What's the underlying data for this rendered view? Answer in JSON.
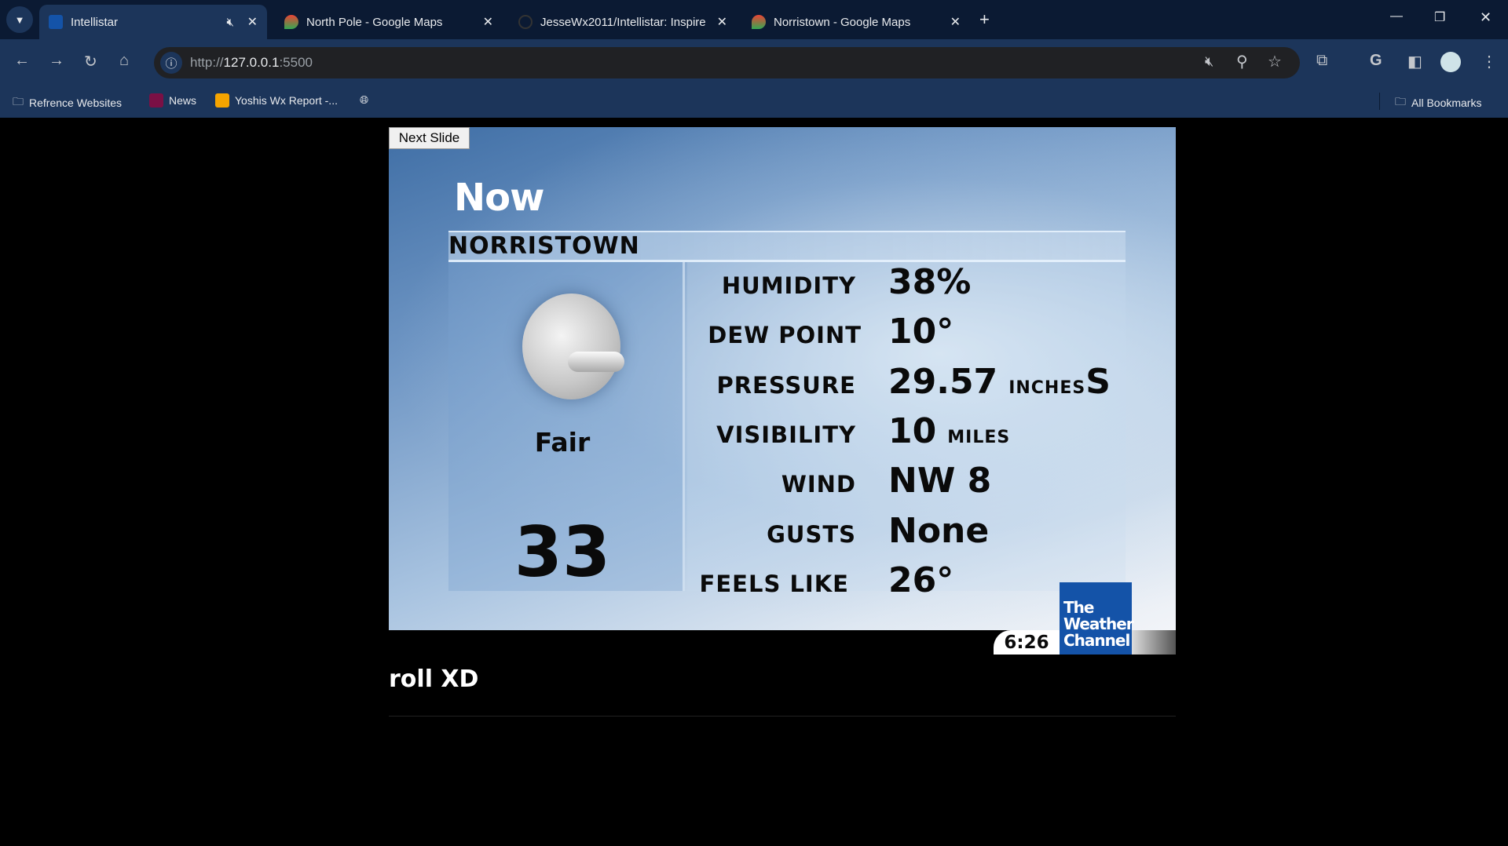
{
  "browser": {
    "tabs": [
      {
        "label": "Intellistar",
        "active": true
      },
      {
        "label": "North Pole - Google Maps"
      },
      {
        "label": "JesseWx2011/Intellistar: Inspire"
      },
      {
        "label": "Norristown - Google Maps"
      }
    ],
    "url_scheme": "http://",
    "url_host": "127.0.0.1",
    "url_port": ":5500",
    "bookmarks": [
      "Refrence Websites",
      "News",
      "Yoshis Wx Report -..."
    ],
    "all_bookmarks": "All Bookmarks"
  },
  "slide": {
    "next_button": "Next Slide",
    "title": "Now",
    "city": "NORRISTOWN",
    "condition": "Fair",
    "condition_icon": "moon-partly-cloudy-icon",
    "temperature": "33",
    "rows": [
      {
        "label": "HUMIDITY",
        "value": "38%",
        "unit": ""
      },
      {
        "label": "DEW POINT",
        "value": "10°",
        "unit": ""
      },
      {
        "label": "PRESSURE",
        "value": "29.57",
        "unit": "INCHES",
        "suffix": "S"
      },
      {
        "label": "VISIBILITY",
        "value": "10",
        "unit": "MILES"
      },
      {
        "label": "WIND",
        "value": "NW 8",
        "unit": ""
      },
      {
        "label": "GUSTS",
        "value": "None",
        "unit": ""
      },
      {
        "label": "FEELS LIKE",
        "value": "26°",
        "unit": ""
      }
    ],
    "logo": "The Weather Channel",
    "clock": "6:26"
  },
  "ticker": "roll XD",
  "colors": {
    "logo_blue": "#1453a8",
    "browser_frame": "#1c355a"
  }
}
